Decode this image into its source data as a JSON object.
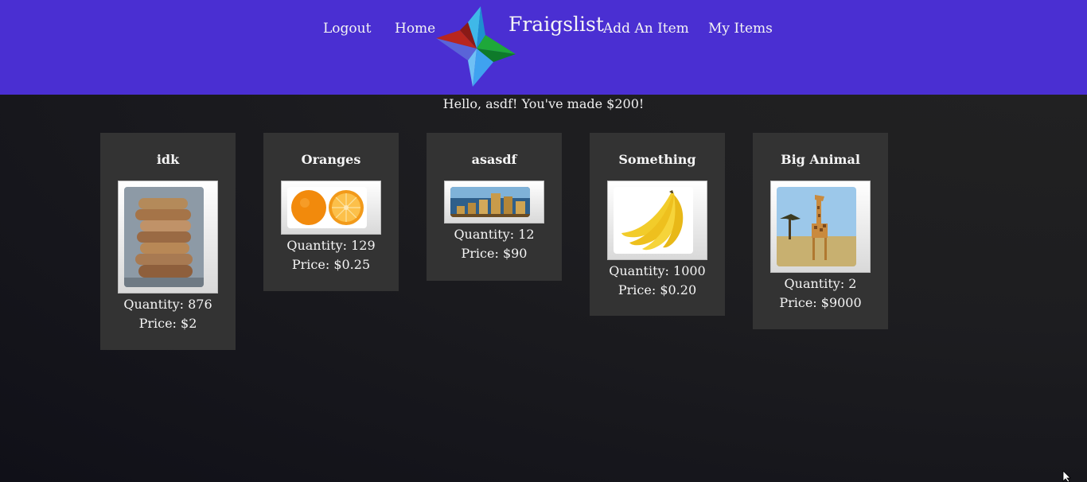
{
  "nav": {
    "logout_label": "Logout",
    "home_label": "Home",
    "brand_title": "Fraigslist",
    "add_item_label": "Add An Item",
    "my_items_label": "My Items"
  },
  "greeting": "Hello, asdf! You've made $200!",
  "items": [
    {
      "title": "idk",
      "quantity": "Quantity: 876",
      "price": "Price: $2",
      "image": "cookie-stack-image"
    },
    {
      "title": "Oranges",
      "quantity": "Quantity: 129",
      "price": "Price: $0.25",
      "image": "oranges-image"
    },
    {
      "title": "asasdf",
      "quantity": "Quantity: 12",
      "price": "Price: $90",
      "image": "coin-stacks-image"
    },
    {
      "title": "Something",
      "quantity": "Quantity: 1000",
      "price": "Price: $0.20",
      "image": "bananas-image"
    },
    {
      "title": "Big Animal",
      "quantity": "Quantity: 2",
      "price": "Price: $9000",
      "image": "giraffe-image"
    }
  ],
  "colors": {
    "navbar": "#4a2fd2",
    "card": "#333333",
    "background": "#1d1d20"
  }
}
